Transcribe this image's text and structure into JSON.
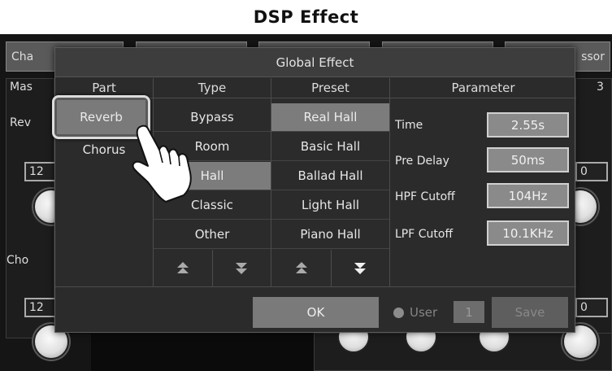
{
  "window": {
    "title": "DSP Effect"
  },
  "background": {
    "tabs": [
      "Cha",
      "ssor"
    ],
    "labels": {
      "mas": "Mas",
      "rev": "Rev",
      "cho": "Cho",
      "right_num": "3"
    },
    "values": {
      "left_top": "12",
      "left_bottom": "12",
      "right_top": "0",
      "right_bottom": "0"
    }
  },
  "dialog": {
    "title": "Global Effect",
    "columns": {
      "part": "Part",
      "type": "Type",
      "preset": "Preset",
      "parameter": "Parameter"
    },
    "parts": [
      {
        "label": "Reverb",
        "selected": true
      },
      {
        "label": "Chorus",
        "selected": false
      }
    ],
    "types": [
      {
        "label": "Bypass",
        "selected": false
      },
      {
        "label": "Room",
        "selected": false
      },
      {
        "label": "Hall",
        "selected": true
      },
      {
        "label": "Classic",
        "selected": false
      },
      {
        "label": "Other",
        "selected": false
      }
    ],
    "presets": [
      {
        "label": "Real Hall",
        "selected": true
      },
      {
        "label": "Basic Hall",
        "selected": false
      },
      {
        "label": "Ballad Hall",
        "selected": false
      },
      {
        "label": "Light Hall",
        "selected": false
      },
      {
        "label": "Piano Hall",
        "selected": false
      }
    ],
    "parameters": [
      {
        "label": "Time",
        "value": "2.55s"
      },
      {
        "label": "Pre Delay",
        "value": "50ms"
      },
      {
        "label": "HPF Cutoff",
        "value": "104Hz"
      },
      {
        "label": "LPF Cutoff",
        "value": "10.1KHz"
      }
    ],
    "scroll_icons": [
      "page-up-icon",
      "page-down-icon",
      "page-up-icon",
      "page-down-icon"
    ],
    "ok_label": "OK",
    "user": {
      "label": "User",
      "number": "1"
    },
    "save_label": "Save"
  },
  "colors": {
    "selected_cell": "#7c7c7c",
    "dialog_bg": "#2b2b2b",
    "title_bar": "#ffffff"
  }
}
